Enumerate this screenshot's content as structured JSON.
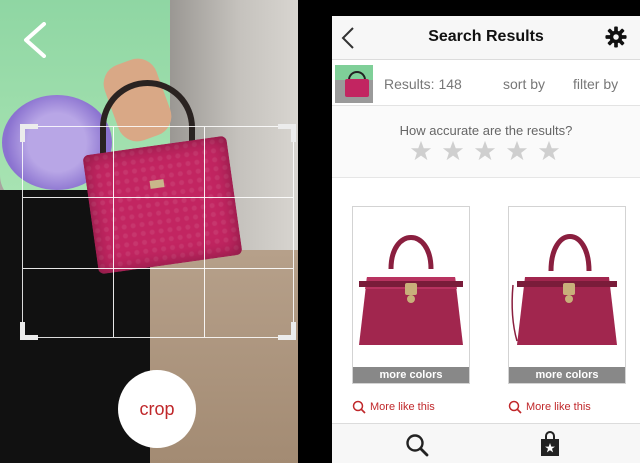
{
  "camera": {
    "crop_label": "crop",
    "back_icon": "chevron-left-icon"
  },
  "header": {
    "title": "Search Results",
    "back_icon": "chevron-left-icon",
    "settings_icon": "gear-icon"
  },
  "results_bar": {
    "count_label": "Results: 148",
    "sort_label": "sort by",
    "filter_label": "filter by"
  },
  "rating": {
    "question": "How accurate are the results?",
    "stars_total": 5,
    "stars_selected": 0,
    "star_color": "#cfcfcf"
  },
  "results": [
    {
      "more_colors_label": "more colors",
      "more_like_label": "More like this"
    },
    {
      "more_colors_label": "more colors",
      "more_like_label": "More like this"
    }
  ],
  "bottom_tabs": [
    {
      "icon": "search-icon"
    },
    {
      "icon": "shopping-bag-star-icon"
    }
  ],
  "colors": {
    "accent": "#c0282b",
    "bag": "#a1264e",
    "more_colors_bar": "#888888"
  }
}
